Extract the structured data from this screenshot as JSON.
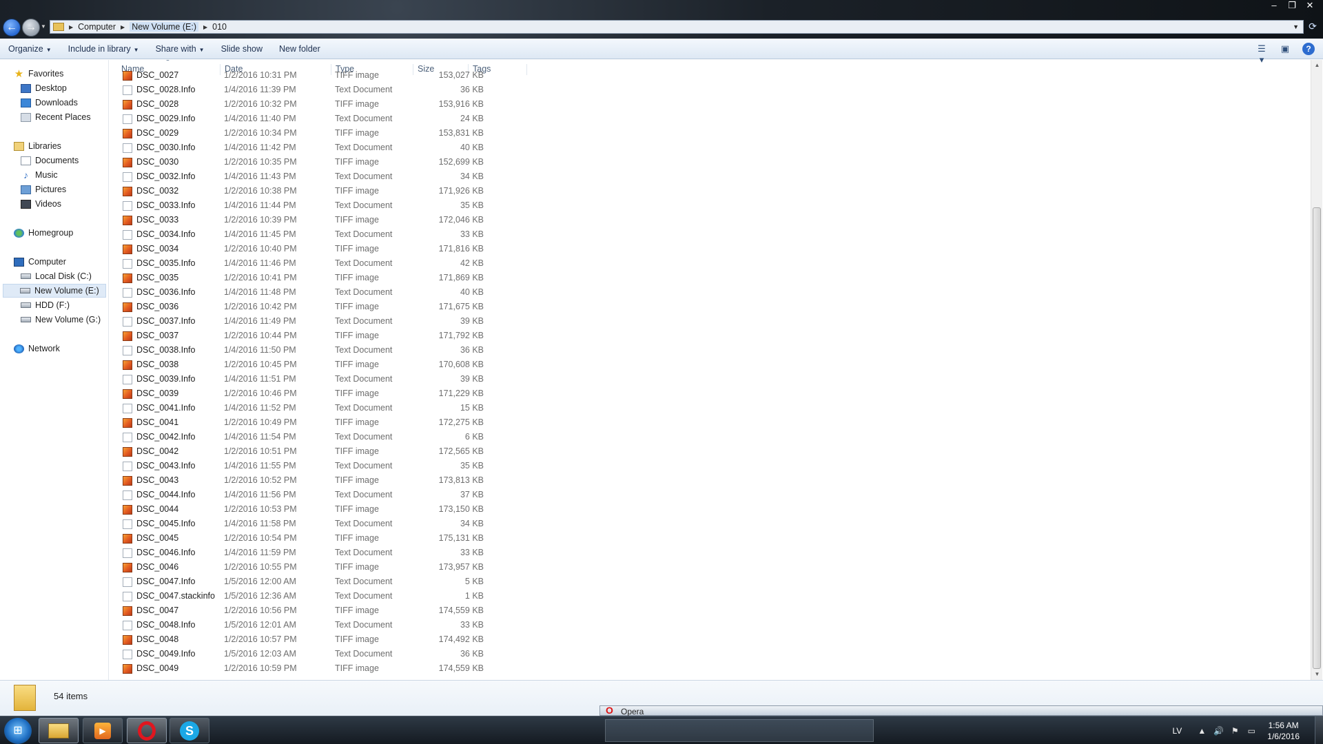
{
  "address": {
    "crumbs": [
      "Computer",
      "New Volume (E:)",
      "010"
    ]
  },
  "window_controls": {
    "minimize": "–",
    "maximize": "❐",
    "close": "✕"
  },
  "toolbar": {
    "organize": "Organize",
    "include_in_library": "Include in library",
    "share_with": "Share with",
    "slide_show": "Slide show",
    "new_folder": "New folder"
  },
  "nav": {
    "favorites": "Favorites",
    "desktop": "Desktop",
    "downloads": "Downloads",
    "recent_places": "Recent Places",
    "libraries": "Libraries",
    "documents": "Documents",
    "music": "Music",
    "pictures": "Pictures",
    "videos": "Videos",
    "homegroup": "Homegroup",
    "computer": "Computer",
    "local_disk": "Local Disk (C:)",
    "new_volume_e": "New Volume (E:)",
    "hdd_f": "HDD (F:)",
    "new_volume_g": "New Volume (G:)",
    "network": "Network"
  },
  "columns": {
    "name": "Name",
    "date": "Date",
    "type": "Type",
    "size": "Size",
    "tags": "Tags"
  },
  "files": [
    {
      "name": "DSC_0027",
      "date": "1/2/2016 10:31 PM",
      "type": "TIFF image",
      "size": "153,027 KB",
      "kind": "tiff"
    },
    {
      "name": "DSC_0028.Info",
      "date": "1/4/2016 11:39 PM",
      "type": "Text Document",
      "size": "36 KB",
      "kind": "txt"
    },
    {
      "name": "DSC_0028",
      "date": "1/2/2016 10:32 PM",
      "type": "TIFF image",
      "size": "153,916 KB",
      "kind": "tiff"
    },
    {
      "name": "DSC_0029.Info",
      "date": "1/4/2016 11:40 PM",
      "type": "Text Document",
      "size": "24 KB",
      "kind": "txt"
    },
    {
      "name": "DSC_0029",
      "date": "1/2/2016 10:34 PM",
      "type": "TIFF image",
      "size": "153,831 KB",
      "kind": "tiff"
    },
    {
      "name": "DSC_0030.Info",
      "date": "1/4/2016 11:42 PM",
      "type": "Text Document",
      "size": "40 KB",
      "kind": "txt"
    },
    {
      "name": "DSC_0030",
      "date": "1/2/2016 10:35 PM",
      "type": "TIFF image",
      "size": "152,699 KB",
      "kind": "tiff"
    },
    {
      "name": "DSC_0032.Info",
      "date": "1/4/2016 11:43 PM",
      "type": "Text Document",
      "size": "34 KB",
      "kind": "txt"
    },
    {
      "name": "DSC_0032",
      "date": "1/2/2016 10:38 PM",
      "type": "TIFF image",
      "size": "171,926 KB",
      "kind": "tiff"
    },
    {
      "name": "DSC_0033.Info",
      "date": "1/4/2016 11:44 PM",
      "type": "Text Document",
      "size": "35 KB",
      "kind": "txt"
    },
    {
      "name": "DSC_0033",
      "date": "1/2/2016 10:39 PM",
      "type": "TIFF image",
      "size": "172,046 KB",
      "kind": "tiff"
    },
    {
      "name": "DSC_0034.Info",
      "date": "1/4/2016 11:45 PM",
      "type": "Text Document",
      "size": "33 KB",
      "kind": "txt"
    },
    {
      "name": "DSC_0034",
      "date": "1/2/2016 10:40 PM",
      "type": "TIFF image",
      "size": "171,816 KB",
      "kind": "tiff"
    },
    {
      "name": "DSC_0035.Info",
      "date": "1/4/2016 11:46 PM",
      "type": "Text Document",
      "size": "42 KB",
      "kind": "txt"
    },
    {
      "name": "DSC_0035",
      "date": "1/2/2016 10:41 PM",
      "type": "TIFF image",
      "size": "171,869 KB",
      "kind": "tiff"
    },
    {
      "name": "DSC_0036.Info",
      "date": "1/4/2016 11:48 PM",
      "type": "Text Document",
      "size": "40 KB",
      "kind": "txt"
    },
    {
      "name": "DSC_0036",
      "date": "1/2/2016 10:42 PM",
      "type": "TIFF image",
      "size": "171,675 KB",
      "kind": "tiff"
    },
    {
      "name": "DSC_0037.Info",
      "date": "1/4/2016 11:49 PM",
      "type": "Text Document",
      "size": "39 KB",
      "kind": "txt"
    },
    {
      "name": "DSC_0037",
      "date": "1/2/2016 10:44 PM",
      "type": "TIFF image",
      "size": "171,792 KB",
      "kind": "tiff"
    },
    {
      "name": "DSC_0038.Info",
      "date": "1/4/2016 11:50 PM",
      "type": "Text Document",
      "size": "36 KB",
      "kind": "txt"
    },
    {
      "name": "DSC_0038",
      "date": "1/2/2016 10:45 PM",
      "type": "TIFF image",
      "size": "170,608 KB",
      "kind": "tiff"
    },
    {
      "name": "DSC_0039.Info",
      "date": "1/4/2016 11:51 PM",
      "type": "Text Document",
      "size": "39 KB",
      "kind": "txt"
    },
    {
      "name": "DSC_0039",
      "date": "1/2/2016 10:46 PM",
      "type": "TIFF image",
      "size": "171,229 KB",
      "kind": "tiff"
    },
    {
      "name": "DSC_0041.Info",
      "date": "1/4/2016 11:52 PM",
      "type": "Text Document",
      "size": "15 KB",
      "kind": "txt"
    },
    {
      "name": "DSC_0041",
      "date": "1/2/2016 10:49 PM",
      "type": "TIFF image",
      "size": "172,275 KB",
      "kind": "tiff"
    },
    {
      "name": "DSC_0042.Info",
      "date": "1/4/2016 11:54 PM",
      "type": "Text Document",
      "size": "6 KB",
      "kind": "txt"
    },
    {
      "name": "DSC_0042",
      "date": "1/2/2016 10:51 PM",
      "type": "TIFF image",
      "size": "172,565 KB",
      "kind": "tiff"
    },
    {
      "name": "DSC_0043.Info",
      "date": "1/4/2016 11:55 PM",
      "type": "Text Document",
      "size": "35 KB",
      "kind": "txt"
    },
    {
      "name": "DSC_0043",
      "date": "1/2/2016 10:52 PM",
      "type": "TIFF image",
      "size": "173,813 KB",
      "kind": "tiff"
    },
    {
      "name": "DSC_0044.Info",
      "date": "1/4/2016 11:56 PM",
      "type": "Text Document",
      "size": "37 KB",
      "kind": "txt"
    },
    {
      "name": "DSC_0044",
      "date": "1/2/2016 10:53 PM",
      "type": "TIFF image",
      "size": "173,150 KB",
      "kind": "tiff"
    },
    {
      "name": "DSC_0045.Info",
      "date": "1/4/2016 11:58 PM",
      "type": "Text Document",
      "size": "34 KB",
      "kind": "txt"
    },
    {
      "name": "DSC_0045",
      "date": "1/2/2016 10:54 PM",
      "type": "TIFF image",
      "size": "175,131 KB",
      "kind": "tiff"
    },
    {
      "name": "DSC_0046.Info",
      "date": "1/4/2016 11:59 PM",
      "type": "Text Document",
      "size": "33 KB",
      "kind": "txt"
    },
    {
      "name": "DSC_0046",
      "date": "1/2/2016 10:55 PM",
      "type": "TIFF image",
      "size": "173,957 KB",
      "kind": "tiff"
    },
    {
      "name": "DSC_0047.Info",
      "date": "1/5/2016 12:00 AM",
      "type": "Text Document",
      "size": "5 KB",
      "kind": "txt"
    },
    {
      "name": "DSC_0047.stackinfo",
      "date": "1/5/2016 12:36 AM",
      "type": "Text Document",
      "size": "1 KB",
      "kind": "txt"
    },
    {
      "name": "DSC_0047",
      "date": "1/2/2016 10:56 PM",
      "type": "TIFF image",
      "size": "174,559 KB",
      "kind": "tiff"
    },
    {
      "name": "DSC_0048.Info",
      "date": "1/5/2016 12:01 AM",
      "type": "Text Document",
      "size": "33 KB",
      "kind": "txt"
    },
    {
      "name": "DSC_0048",
      "date": "1/2/2016 10:57 PM",
      "type": "TIFF image",
      "size": "174,492 KB",
      "kind": "tiff"
    },
    {
      "name": "DSC_0049.Info",
      "date": "1/5/2016 12:03 AM",
      "type": "Text Document",
      "size": "36 KB",
      "kind": "txt"
    },
    {
      "name": "DSC_0049",
      "date": "1/2/2016 10:59 PM",
      "type": "TIFF image",
      "size": "174,559 KB",
      "kind": "tiff"
    }
  ],
  "details": {
    "item_count": "54 items"
  },
  "opera_tab": {
    "label": "Opera"
  },
  "taskbar": {
    "language": "LV",
    "time": "1:56 AM",
    "date": "1/6/2016"
  },
  "colors": {
    "accent": "#2d6ccf",
    "tiff_icon": "#e35b21",
    "selection": "#dfeaf7"
  },
  "icons": {
    "explorer": "folder-icon",
    "media": "media-player-icon",
    "opera": "opera-icon",
    "skype": "skype-icon"
  }
}
